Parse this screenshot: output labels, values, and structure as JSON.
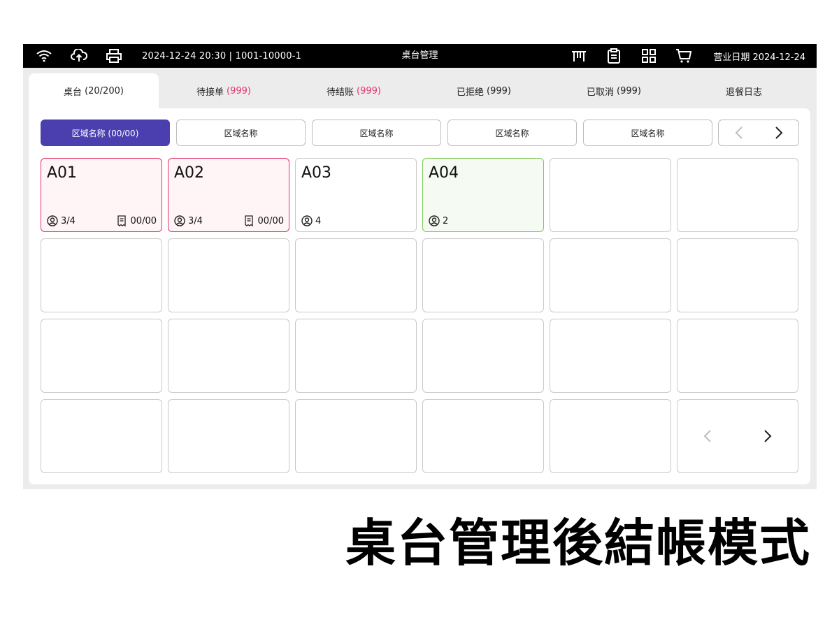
{
  "statusbar": {
    "datetime": "2024-12-24 20:30 | 1001-10000-1",
    "title": "桌台管理",
    "business_date": "营业日期 2024-12-24",
    "left_icons": [
      "wifi-icon",
      "cloud-upload-icon",
      "printer-icon"
    ],
    "right_icons": [
      "table-icon",
      "clipboard-icon",
      "grid-icon",
      "cart-icon"
    ]
  },
  "tabs": [
    {
      "label": "桌台",
      "count": "(20/200)",
      "active": true,
      "count_color": "#222222"
    },
    {
      "label": "待接单",
      "count": "(999)",
      "active": false,
      "count_color": "#e8336b"
    },
    {
      "label": "待结账",
      "count": "(999)",
      "active": false,
      "count_color": "#e8336b"
    },
    {
      "label": "已拒绝",
      "count": "(999)",
      "active": false,
      "count_color": "#222222"
    },
    {
      "label": "已取消",
      "count": "(999)",
      "active": false,
      "count_color": "#222222"
    },
    {
      "label": "退餐日志",
      "count": "",
      "active": false,
      "count_color": "#222222"
    }
  ],
  "areas": [
    {
      "label": "区域名称 (00/00)",
      "active": true
    },
    {
      "label": "区域名称",
      "active": false
    },
    {
      "label": "区域名称",
      "active": false
    },
    {
      "label": "区域名称",
      "active": false
    },
    {
      "label": "区域名称",
      "active": false
    }
  ],
  "tables": [
    {
      "name": "A01",
      "guests": "3/4",
      "orders": "00/00",
      "status": "pink"
    },
    {
      "name": "A02",
      "guests": "3/4",
      "orders": "00/00",
      "status": "pink"
    },
    {
      "name": "A03",
      "guests": "4",
      "orders": "",
      "status": "normal"
    },
    {
      "name": "A04",
      "guests": "2",
      "orders": "",
      "status": "green"
    }
  ],
  "grid": {
    "total_cells": 24
  },
  "colors": {
    "accent": "#4b3fb0",
    "occupied": "#e0336a",
    "available": "#7ac653"
  },
  "caption": "桌台管理後結帳模式"
}
